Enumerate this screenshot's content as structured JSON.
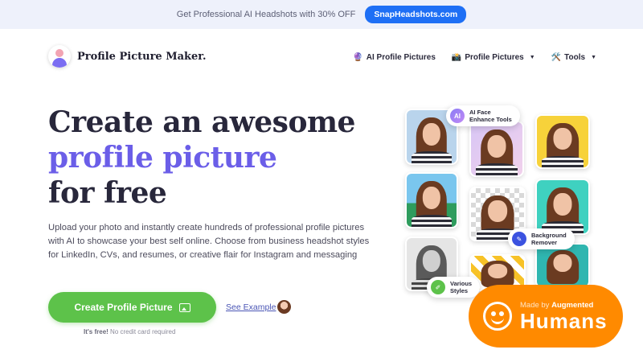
{
  "promo": {
    "text": "Get Professional AI Headshots with 30% OFF",
    "button": "SnapHeadshots.com"
  },
  "header": {
    "logo_text": "Profile Picture Maker.",
    "nav": [
      {
        "emoji": "🔮",
        "label": "AI Profile Pictures",
        "dropdown": false
      },
      {
        "emoji": "📸",
        "label": "Profile Pictures",
        "dropdown": true
      },
      {
        "emoji": "🛠️",
        "label": "Tools",
        "dropdown": true
      }
    ]
  },
  "hero": {
    "title_line1": "Create an awesome",
    "title_line2": "profile picture",
    "title_line3": "for free",
    "description": "Upload your photo and instantly create hundreds of professional profile pictures with AI to showcase your best self online. Choose from business headshot styles for LinkedIn, CVs, and resumes, or creative flair for Instagram and messaging",
    "cta_label": "Create Profile Picture",
    "see_example": "See Example",
    "free_note_bold": "It's free!",
    "free_note_rest": "No credit card required"
  },
  "collage": {
    "badge_ai": {
      "icon": "AI",
      "line1": "AI Face",
      "line2": "Enhance Tools"
    },
    "badge_bg": {
      "line1": "Background",
      "line2": "Remover"
    },
    "badge_styles": {
      "line1": "Various",
      "line2": "Styles"
    }
  },
  "made_by": {
    "prefix": "Made by",
    "brand_small": "Augmented",
    "brand_big": "Humans",
    "color": "#ff8a00"
  },
  "colors": {
    "accent": "#6b5ee8",
    "cta": "#5dc24a",
    "promo_button": "#1e6ff5"
  }
}
